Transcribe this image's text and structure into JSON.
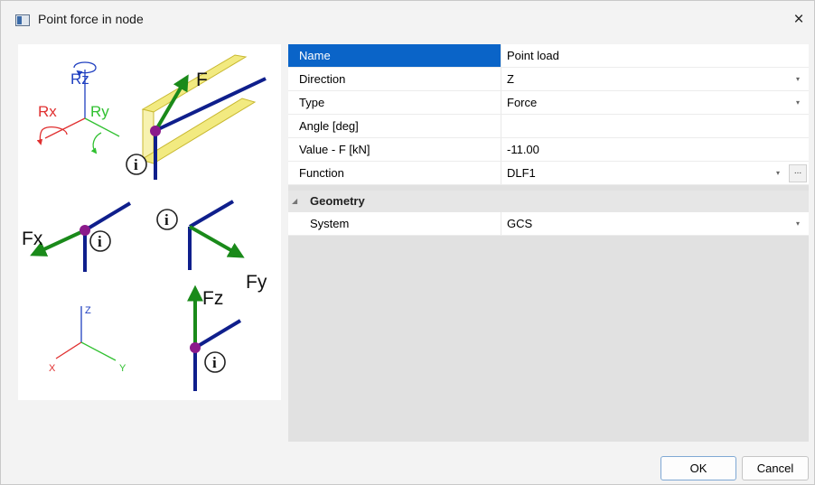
{
  "window": {
    "title": "Point force in node",
    "close_glyph": "×"
  },
  "preview": {
    "labels": {
      "f": "F",
      "rz": "Rz",
      "rx": "Rx",
      "ry": "Ry",
      "fx": "Fx",
      "fy": "Fy",
      "fz": "Fz",
      "node": "i",
      "axis_z": "Z",
      "axis_x": "X",
      "axis_y": "Y"
    },
    "colors": {
      "force": "#1a8a1a",
      "member": "#0f1f8c",
      "node": "#8b1a8b",
      "rx": "#e03030",
      "ry": "#30c030",
      "rz": "#2040c0",
      "beam": "#f2ea80"
    }
  },
  "properties": {
    "rows": [
      {
        "label": "Name",
        "value": "Point load",
        "selected": true,
        "dropdown": false
      },
      {
        "label": "Direction",
        "value": "Z",
        "dropdown": true
      },
      {
        "label": "Type",
        "value": "Force",
        "dropdown": true
      },
      {
        "label": "Angle [deg]",
        "value": "",
        "dropdown": false
      },
      {
        "label": "Value - F [kN]",
        "value": "-11.00",
        "dropdown": false
      },
      {
        "label": "Function",
        "value": "DLF1",
        "dropdown": true,
        "more_button": "..."
      }
    ],
    "group": {
      "label": "Geometry",
      "rows": [
        {
          "label": "System",
          "value": "GCS",
          "dropdown": true
        }
      ]
    },
    "dropdown_glyph": "▾",
    "collapse_glyph": "◢"
  },
  "buttons": {
    "ok": "OK",
    "cancel": "Cancel"
  }
}
